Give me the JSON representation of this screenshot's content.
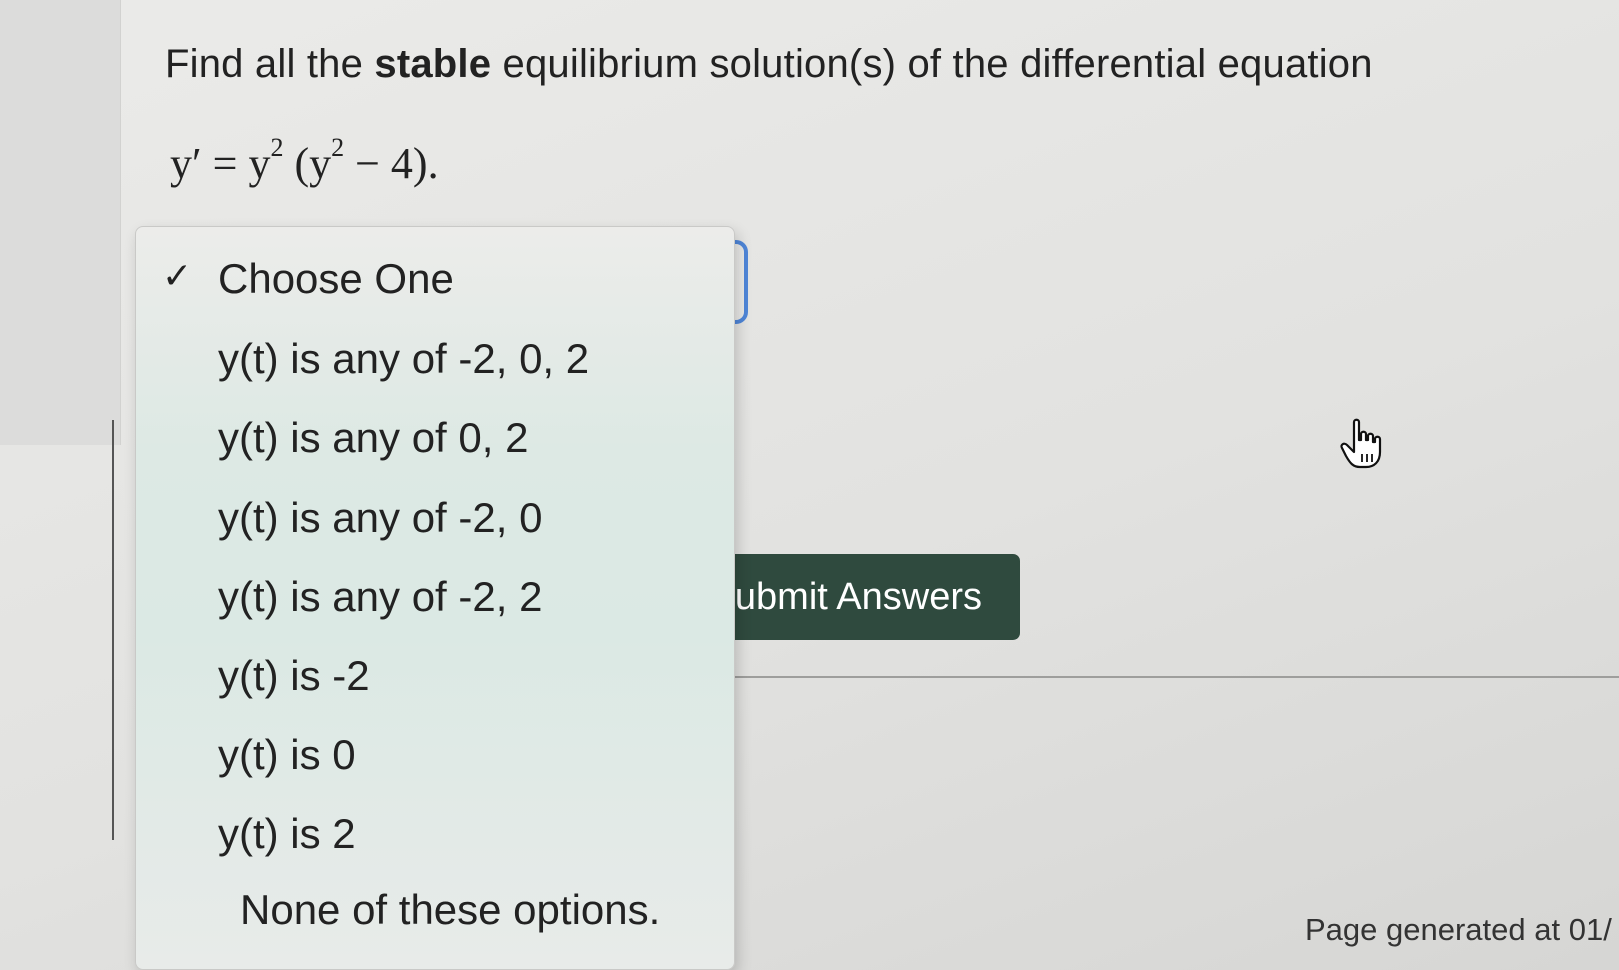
{
  "question": {
    "prefix": "Find all the ",
    "bold": "stable",
    "suffix": " equilibrium solution(s) of the differential equation"
  },
  "equation": {
    "lhs": "y′ = y",
    "exp1": "2",
    "mid": " (y",
    "exp2": "2",
    "rhs": " − 4)."
  },
  "dropdown": {
    "check": "✓",
    "options": [
      "Choose One",
      "y(t) is any of -2, 0, 2",
      "y(t) is any of 0, 2",
      "y(t) is any of -2, 0",
      "y(t) is any of -2, 2",
      "y(t) is -2",
      "y(t) is 0",
      "y(t) is 2",
      "None of these options."
    ]
  },
  "submit": {
    "label": "Submit Answers"
  },
  "footer": {
    "text": "Page generated at 01/"
  },
  "colors": {
    "accent": "#4f86d8",
    "submit_bg": "#2f4a3e"
  },
  "icons": {
    "cursor": "hand-pointer-icon",
    "check": "checkmark-icon"
  }
}
